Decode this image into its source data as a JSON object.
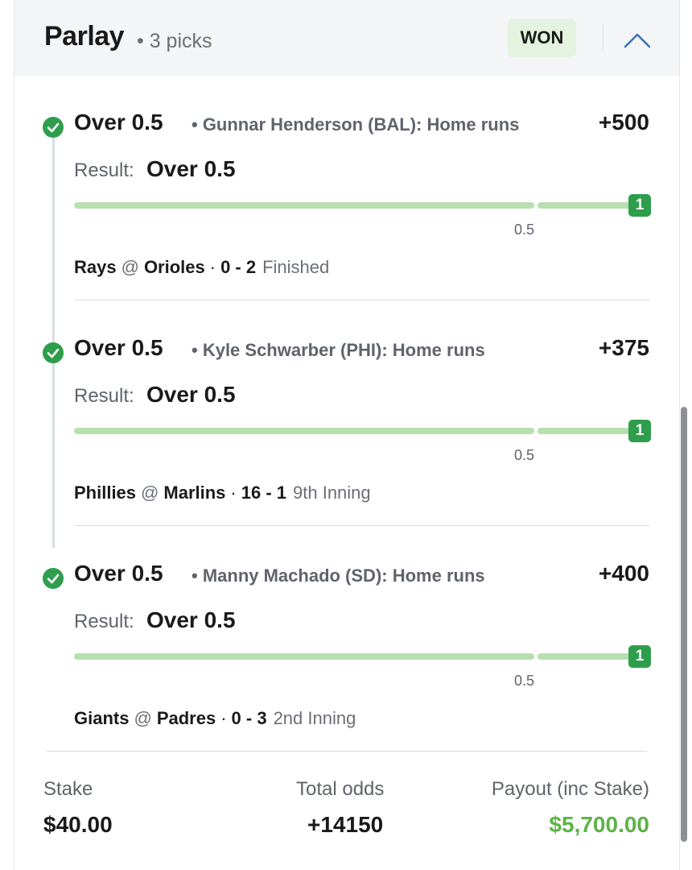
{
  "header": {
    "title": "Parlay",
    "subtitle": "• 3 picks",
    "status_badge": "WON"
  },
  "picks": [
    {
      "selection": "Over 0.5",
      "meta": "• Gunnar Henderson (BAL): Home runs",
      "odds": "+500",
      "result_label": "Result:",
      "result_value": "Over 0.5",
      "progress_value": "1",
      "threshold": "0.5",
      "away_team": "Rays",
      "at": "@",
      "home_team": "Orioles",
      "separator": "·",
      "score": "0 - 2",
      "game_status": "Finished"
    },
    {
      "selection": "Over 0.5",
      "meta": "• Kyle Schwarber (PHI): Home runs",
      "odds": "+375",
      "result_label": "Result:",
      "result_value": "Over 0.5",
      "progress_value": "1",
      "threshold": "0.5",
      "away_team": "Phillies",
      "at": "@",
      "home_team": "Marlins",
      "separator": "·",
      "score": "16 - 1",
      "game_status": "9th Inning"
    },
    {
      "selection": "Over 0.5",
      "meta": "• Manny Machado (SD): Home runs",
      "odds": "+400",
      "result_label": "Result:",
      "result_value": "Over 0.5",
      "progress_value": "1",
      "threshold": "0.5",
      "away_team": "Giants",
      "at": "@",
      "home_team": "Padres",
      "separator": "·",
      "score": "0 - 3",
      "game_status": "2nd Inning"
    }
  ],
  "footer": {
    "stake_label": "Stake",
    "stake_value": "$40.00",
    "odds_label": "Total odds",
    "odds_value": "+14150",
    "payout_label": "Payout (inc Stake)",
    "payout_value": "$5,700.00"
  },
  "colors": {
    "won_badge_bg": "#e4f3df",
    "success_green": "#2e9e4c",
    "progress_fill": "#b9dfb0",
    "payout_green": "#5cb346",
    "header_bg": "#f4f5f7"
  },
  "icons": {
    "check": "check-circle-icon",
    "collapse": "chevron-up-icon"
  }
}
